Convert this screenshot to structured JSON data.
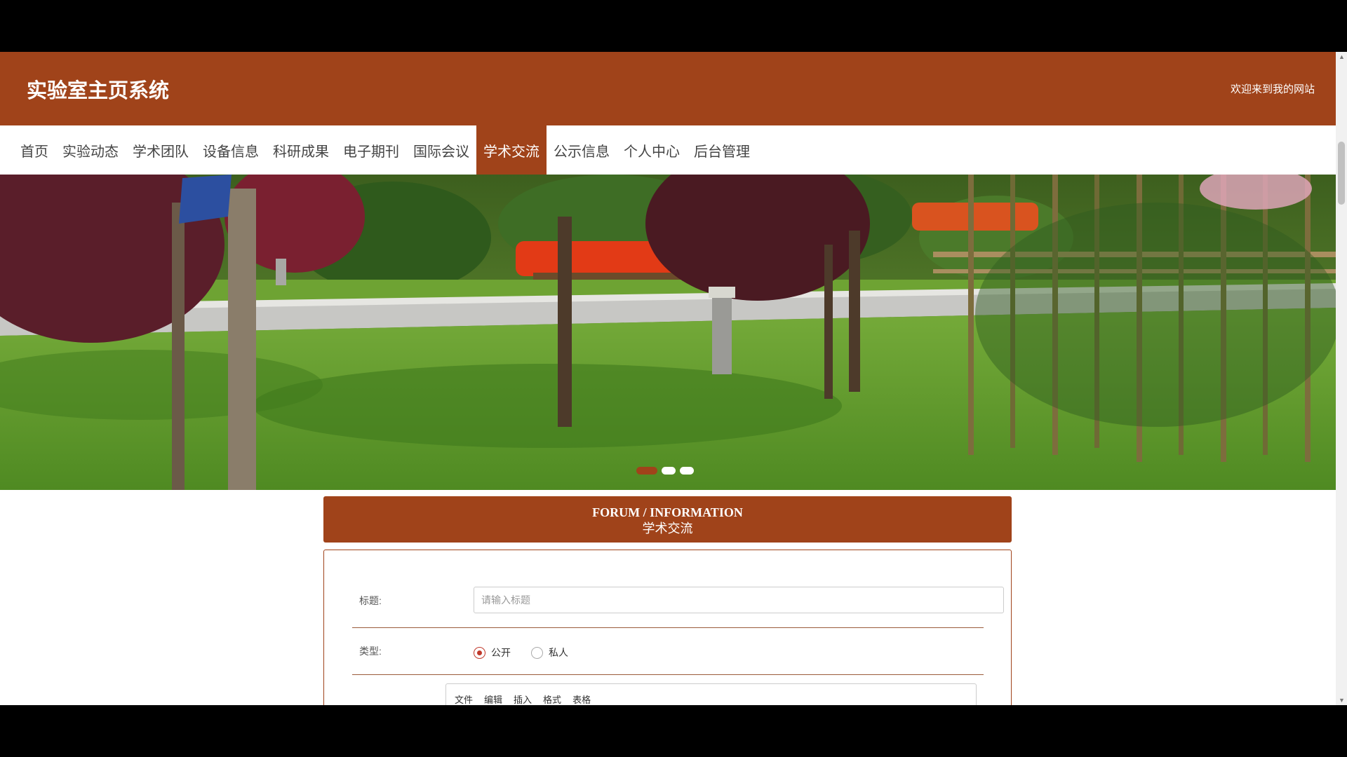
{
  "header": {
    "site_title": "实验室主页系统",
    "welcome": "欢迎来到我的网站"
  },
  "nav": {
    "items": [
      {
        "label": "首页"
      },
      {
        "label": "实验动态"
      },
      {
        "label": "学术团队"
      },
      {
        "label": "设备信息"
      },
      {
        "label": "科研成果"
      },
      {
        "label": "电子期刊"
      },
      {
        "label": "国际会议"
      },
      {
        "label": "学术交流"
      },
      {
        "label": "公示信息"
      },
      {
        "label": "个人中心"
      },
      {
        "label": "后台管理"
      }
    ],
    "active_index": 7
  },
  "banner": {
    "slide_count": 3,
    "active_slide": 1
  },
  "section": {
    "title_en": "FORUM / INFORMATION",
    "title_cn": "学术交流"
  },
  "form": {
    "title_label": "标题:",
    "title_placeholder": "请输入标题",
    "type_label": "类型:",
    "type_options": [
      "公开",
      "私人"
    ],
    "type_selected": "公开"
  },
  "editor": {
    "menu": [
      "文件",
      "编辑",
      "插入",
      "格式",
      "表格"
    ]
  },
  "colors": {
    "brand": "#A0431A",
    "radio_checked": "#c0392b"
  },
  "icons": {
    "scroll_up": "triangle-up",
    "scroll_down": "triangle-down"
  }
}
